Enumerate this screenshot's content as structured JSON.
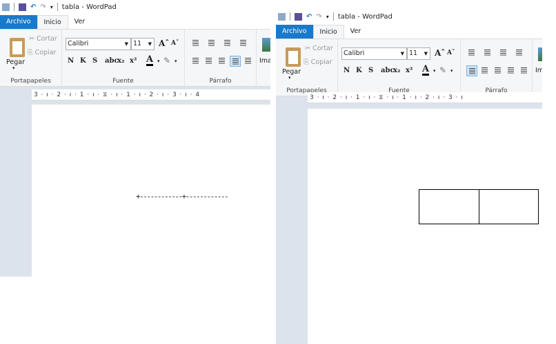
{
  "panels": [
    {
      "id": "before",
      "window_title": "tabla - WordPad",
      "tabs": [
        "Archivo",
        "Inicio",
        "Ver"
      ],
      "clipboard": {
        "paste": "Pegar",
        "cut": "Cortar",
        "copy": "Copiar",
        "label": "Portapapeles"
      },
      "font": {
        "family": "Calibri",
        "size": "11",
        "label": "Fuente",
        "buttons": [
          "N",
          "K",
          "S",
          "abc",
          "x₂",
          "x²"
        ]
      },
      "paragraph": {
        "label": "Párrafo",
        "active_alignment": "justify"
      },
      "insert": {
        "image": "Ima"
      },
      "ruler": "3 · ı · 2 · ı · 1 · ı · ⧖ · ı · 1 · ı · 2 · ı · 3 · ı · 4",
      "document_text": "+------------+------------"
    },
    {
      "id": "after",
      "window_title": "tabla - WordPad",
      "tabs": [
        "Archivo",
        "Inicio",
        "Ver"
      ],
      "clipboard": {
        "paste": "Pegar",
        "cut": "Cortar",
        "copy": "Copiar",
        "label": "Portapapeles"
      },
      "font": {
        "family": "Calibri",
        "size": "11",
        "label": "Fuente",
        "buttons": [
          "N",
          "K",
          "S",
          "abc",
          "x₂",
          "x²"
        ]
      },
      "paragraph": {
        "label": "Párrafo",
        "active_alignment": "left"
      },
      "insert": {
        "image": "Im"
      },
      "ruler": "3 · ı · 2 · ı · 1 · ı · ⧖ · ı · 1 · ı · 2 · ı · 3 · ı",
      "table": {
        "rows": 1,
        "columns": 2
      }
    }
  ],
  "colors": {
    "file_tab": "#1979ca",
    "workspace": "#dce3ec",
    "ribbon": "#f5f6f7"
  }
}
